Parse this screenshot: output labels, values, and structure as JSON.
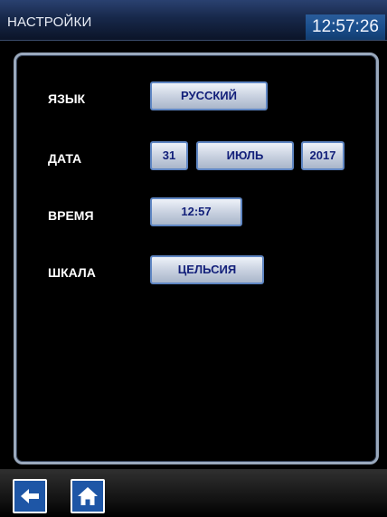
{
  "header": {
    "title": "НАСТРОЙКИ",
    "clock": "12:57:26"
  },
  "settings": {
    "language": {
      "label": "ЯЗЫК",
      "value": "РУССКИЙ"
    },
    "date": {
      "label": "ДАТА",
      "day": "31",
      "month": "ИЮЛЬ",
      "year": "2017"
    },
    "time": {
      "label": "ВРЕМЯ",
      "value": "12:57"
    },
    "scale": {
      "label": "ШКАЛА",
      "value": "ЦЕЛЬСИЯ"
    }
  },
  "footer": {
    "back_icon": "arrow-left-icon",
    "home_icon": "home-icon"
  },
  "colors": {
    "header_bg": "#17284a",
    "clock_bg": "#1a4f8d",
    "button_text": "#13207a",
    "nav_button": "#1e56a6"
  }
}
